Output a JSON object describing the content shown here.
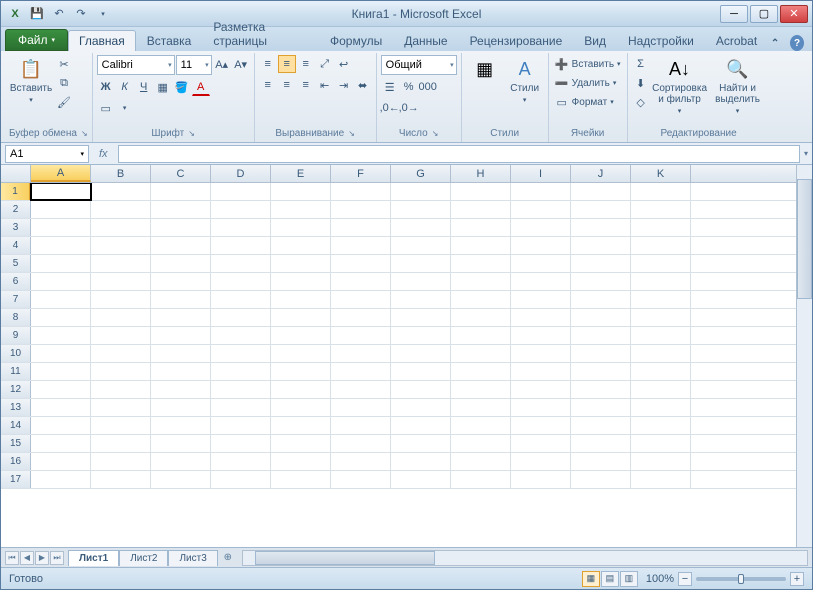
{
  "title": "Книга1 - Microsoft Excel",
  "qat": {
    "save": "💾",
    "undo": "↶",
    "redo": "↷"
  },
  "win": {
    "min": "─",
    "max": "▢",
    "close": "✕"
  },
  "tabs": {
    "file": "Файл",
    "items": [
      "Главная",
      "Вставка",
      "Разметка страницы",
      "Формулы",
      "Данные",
      "Рецензирование",
      "Вид",
      "Надстройки",
      "Acrobat"
    ],
    "active": 0
  },
  "ribbon": {
    "clipboard": {
      "paste": "Вставить",
      "label": "Буфер обмена"
    },
    "font": {
      "name": "Calibri",
      "size": "11",
      "label": "Шрифт"
    },
    "align": {
      "label": "Выравнивание"
    },
    "number": {
      "format": "Общий",
      "label": "Число"
    },
    "styles": {
      "cond": "",
      "styles_btn": "Стили",
      "label": "Стили"
    },
    "cells": {
      "insert": "Вставить",
      "delete": "Удалить",
      "format": "Формат",
      "label": "Ячейки"
    },
    "editing": {
      "sort": "Сортировка и фильтр",
      "find": "Найти и выделить",
      "label": "Редактирование"
    }
  },
  "namebox": "A1",
  "fx": "fx",
  "columns": [
    "A",
    "B",
    "C",
    "D",
    "E",
    "F",
    "G",
    "H",
    "I",
    "J",
    "K"
  ],
  "rows": [
    1,
    2,
    3,
    4,
    5,
    6,
    7,
    8,
    9,
    10,
    11,
    12,
    13,
    14,
    15,
    16,
    17
  ],
  "active_cell": {
    "r": 1,
    "c": "A"
  },
  "sheets": {
    "items": [
      "Лист1",
      "Лист2",
      "Лист3"
    ],
    "active": 0
  },
  "status": {
    "ready": "Готово",
    "zoom": "100%"
  }
}
